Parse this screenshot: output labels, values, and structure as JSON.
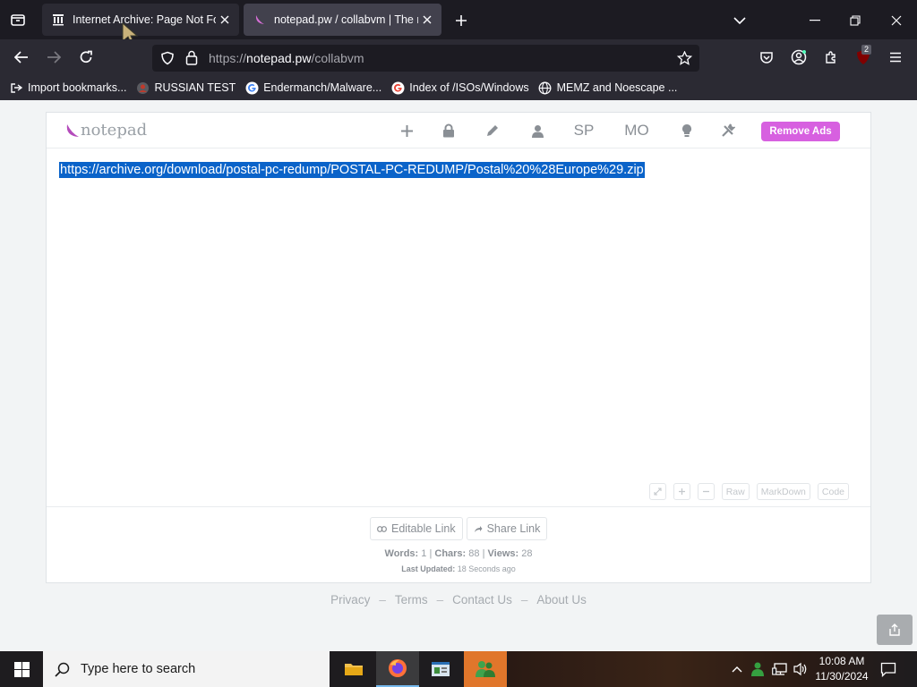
{
  "browser": {
    "tabs": [
      {
        "title": "Internet Archive: Page Not Fou",
        "active": false
      },
      {
        "title": "notepad.pw / collabvm | The na",
        "active": true
      }
    ],
    "address": {
      "scheme": "https://",
      "host": "notepad.pw",
      "path": "/collabvm"
    },
    "extension_badge": "2",
    "bookmarks": [
      {
        "label": "Import bookmarks...",
        "icon": "import-icon"
      },
      {
        "label": "RUSSIAN TEST",
        "icon": "user-circle-icon"
      },
      {
        "label": "Endermanch/Malware...",
        "icon": "google-icon"
      },
      {
        "label": "Index of /ISOs/Windows",
        "icon": "google-icon"
      },
      {
        "label": "MEMZ and Noescape ...",
        "icon": "globe-icon"
      }
    ]
  },
  "notepad": {
    "logo_text": "notepad",
    "header_buttons": {
      "sp": "SP",
      "mo": "MO"
    },
    "remove_ads": "Remove Ads",
    "content": "https://archive.org/download/postal-pc-redump/POSTAL-PC-REDUMP/Postal%20%28Europe%29.zip",
    "editor_tools": {
      "raw": "Raw",
      "markdown": "MarkDown",
      "code": "Code"
    },
    "footer": {
      "editable_link": "Editable Link",
      "share_link": "Share Link",
      "words_label": "Words:",
      "words": "1",
      "chars_label": "Chars:",
      "chars": "88",
      "views_label": "Views:",
      "views": "28",
      "updated_label": "Last Updated:",
      "updated": "18 Seconds ago"
    },
    "page_links": [
      "Privacy",
      "Terms",
      "Contact Us",
      "About Us"
    ]
  },
  "taskbar": {
    "search_placeholder": "Type here to search",
    "time": "10:08 AM",
    "date": "11/30/2024"
  },
  "colors": {
    "accent": "#d760e0",
    "selection": "#0a63c9"
  }
}
